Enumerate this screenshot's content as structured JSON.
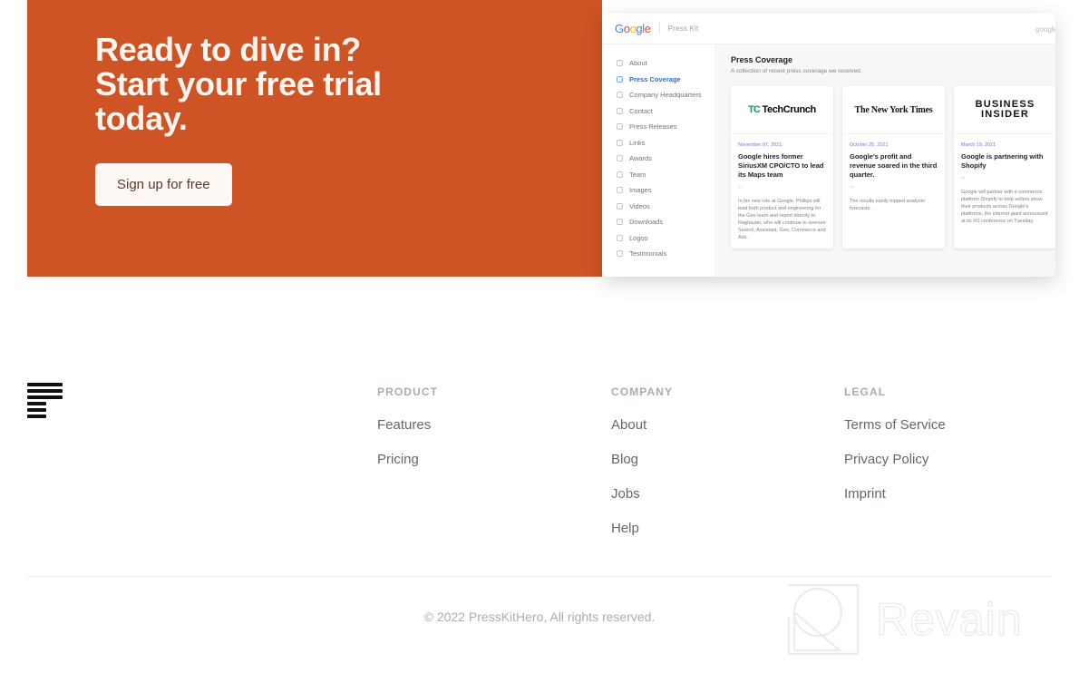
{
  "hero": {
    "headline": "Ready to dive in?\nStart your free trial\ntoday.",
    "cta_label": "Sign up for free",
    "background_color": "#ce5426",
    "cta_background": "#fdf8f3",
    "cta_text_color": "#5a3a2c"
  },
  "app_screenshot": {
    "brand": {
      "g1": "G",
      "o1": "o",
      "o2": "o",
      "g2": "g",
      "l": "l",
      "e": "e"
    },
    "page_label": "Press Kit",
    "top_right_label": "google",
    "sidebar": [
      {
        "label": "About",
        "active": false
      },
      {
        "label": "Press Coverage",
        "active": true
      },
      {
        "label": "Company Headquarters",
        "active": false
      },
      {
        "label": "Contact",
        "active": false
      },
      {
        "label": "Press Releases",
        "active": false
      },
      {
        "label": "Links",
        "active": false
      },
      {
        "label": "Awards",
        "active": false
      },
      {
        "label": "Team",
        "active": false
      },
      {
        "label": "Images",
        "active": false
      },
      {
        "label": "Videos",
        "active": false
      },
      {
        "label": "Downloads",
        "active": false
      },
      {
        "label": "Logos",
        "active": false
      },
      {
        "label": "Testimonials",
        "active": false
      }
    ],
    "content": {
      "heading": "Press Coverage",
      "subheading": "A collection of recent press coverage we received.",
      "cards": [
        {
          "outlet": "TechCrunch",
          "outlet_prefix": "TC",
          "date": "November 07, 2021",
          "title": "Google hires former SiriusXM CPO/CTO to lead its Maps team",
          "quote": "In his new role at Google, Phillips will lead both product and engineering for the Geo team and report directly to Raghavan, who will continue to oversee Search, Assistant, Geo, Commerce and Ads."
        },
        {
          "outlet": "The New York Times",
          "date": "October 26, 2021",
          "title": "Google's profit and revenue soared in the third quarter.",
          "quote": "The results easily topped analysts' forecasts."
        },
        {
          "outlet": "BUSINESS\nINSIDER",
          "date": "March 19, 2021",
          "title": "Google is partnering with Shopify",
          "quote": "Google will partner with e-commerce platform Shopify to help sellers show their products across Google's platforms, the internet giant announced at its I/O conference on Tuesday."
        }
      ]
    },
    "accent_color": "#1a73e8"
  },
  "footer": {
    "logo_name": "presskithero-logo",
    "columns": [
      {
        "heading": "PRODUCT",
        "links": [
          "Features",
          "Pricing"
        ]
      },
      {
        "heading": "COMPANY",
        "links": [
          "About",
          "Blog",
          "Jobs",
          "Help"
        ]
      },
      {
        "heading": "LEGAL",
        "links": [
          "Terms of Service",
          "Privacy Policy",
          "Imprint"
        ]
      }
    ],
    "copyright": "© 2022 PressKitHero, All rights reserved."
  },
  "watermark": {
    "text": "Revain"
  }
}
